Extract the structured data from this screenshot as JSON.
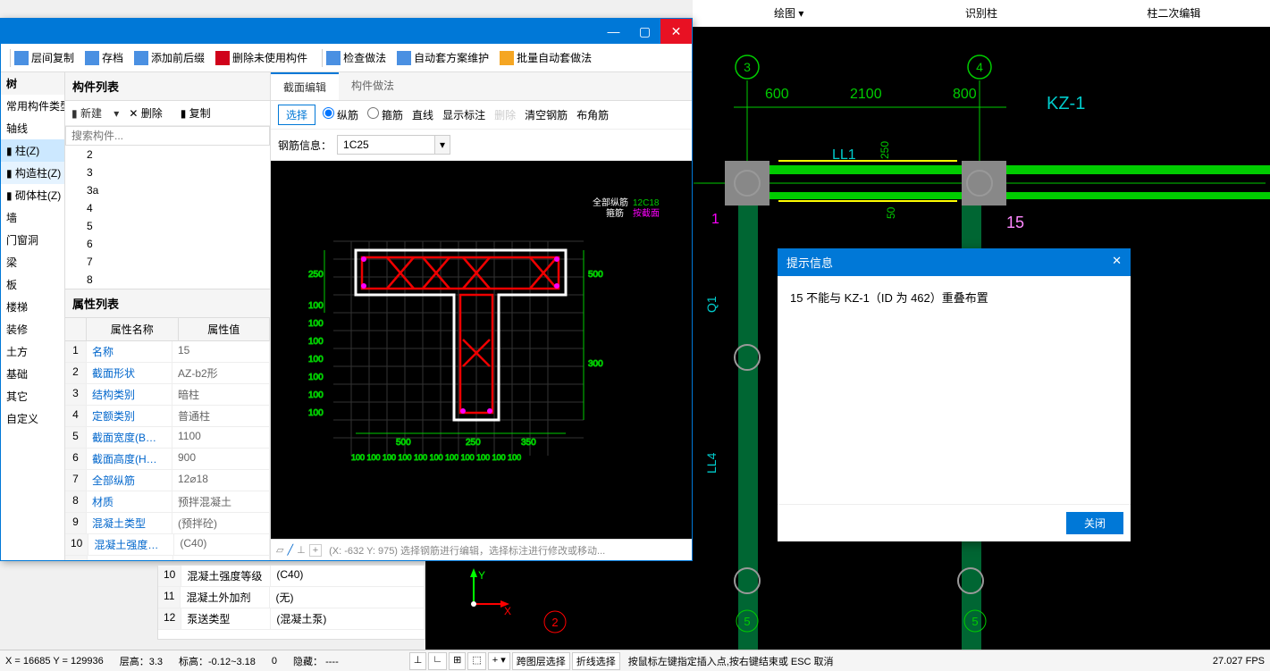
{
  "cad_ribbon": {
    "draw": "绘图",
    "recognize": "识别柱",
    "edit2": "柱二次编辑"
  },
  "toolbar": {
    "layer_copy": "层间复制",
    "archive": "存档",
    "add_prefix": "添加前后缀",
    "delete_unused": "删除未使用构件",
    "check_method": "检查做法",
    "auto_method_maint": "自动套方案维护",
    "batch_auto_method": "批量自动套做法"
  },
  "tree": {
    "title": "树",
    "header": "常用构件类型",
    "items": [
      "轴线",
      "柱(Z)",
      "构造柱(Z)",
      "砌体柱(Z)",
      "墙",
      "门窗洞",
      "梁",
      "板",
      "楼梯",
      "装修",
      "土方",
      "基础",
      "其它",
      "自定义"
    ]
  },
  "comp": {
    "title": "构件列表",
    "new": "新建",
    "delete": "删除",
    "copy": "复制",
    "search_placeholder": "搜索构件...",
    "items": [
      "2",
      "3",
      "3a",
      "4",
      "5",
      "6",
      "7",
      "8"
    ]
  },
  "props": {
    "title": "属性列表",
    "col_name": "属性名称",
    "col_val": "属性值",
    "rows": [
      {
        "n": "1",
        "name": "名称",
        "val": "15"
      },
      {
        "n": "2",
        "name": "截面形状",
        "val": "AZ-b2形"
      },
      {
        "n": "3",
        "name": "结构类别",
        "val": "暗柱"
      },
      {
        "n": "4",
        "name": "定额类别",
        "val": "普通柱"
      },
      {
        "n": "5",
        "name": "截面宽度(B边)(...",
        "val": "1100"
      },
      {
        "n": "6",
        "name": "截面高度(H边)(...",
        "val": "900"
      },
      {
        "n": "7",
        "name": "全部纵筋",
        "val": "12⌀18"
      },
      {
        "n": "8",
        "name": "材质",
        "val": "预拌混凝土"
      },
      {
        "n": "9",
        "name": "混凝土类型",
        "val": "(预拌砼)"
      },
      {
        "n": "10",
        "name": "混凝土强度等级",
        "val": "(C40)"
      },
      {
        "n": "11",
        "name": "混凝土外加剂",
        "val": "(无)"
      },
      {
        "n": "12",
        "name": "泵送类型",
        "val": "(混凝土泵)"
      }
    ]
  },
  "lower_props": [
    {
      "n": "10",
      "name": "混凝土强度等级",
      "val": "(C40)"
    },
    {
      "n": "11",
      "name": "混凝土外加剂",
      "val": "(无)"
    },
    {
      "n": "12",
      "name": "泵送类型",
      "val": "(混凝土泵)"
    }
  ],
  "edit": {
    "tab1": "截面编辑",
    "tab2": "构件做法",
    "select": "选择",
    "radio1": "纵筋",
    "radio2": "箍筋",
    "line": "直线",
    "show_label": "显示标注",
    "delete": "删除",
    "clear": "清空钢筋",
    "corner": "布角筋",
    "rebar_label": "钢筋信息：",
    "rebar_value": "1C25",
    "status": "(X: -632 Y: 975)  选择钢筋进行编辑，选择标注进行修改或移动...",
    "legend1": "全部纵筋",
    "legend1v": "12C18",
    "legend2": "箍筋",
    "legend2v": "按截面"
  },
  "dialog": {
    "title": "提示信息",
    "body": "15 不能与 KZ-1（ID 为 462）重叠布置",
    "close_btn": "关闭"
  },
  "status": {
    "xy": "X = 16685 Y = 129936",
    "floor": "层高：3.3",
    "elev": "标高：-0.12~3.18",
    "zero": "0",
    "hide": "隐藏：",
    "none": "----",
    "cross_layer": "跨图层选择",
    "polyline": "折线选择",
    "hint": "按鼠标左键指定插入点,按右键结束或 ESC 取消",
    "fps": "27.027 FPS"
  },
  "cad": {
    "kz1": "KZ-1",
    "ll1": "LL1",
    "label15": "15",
    "q1": "Q1",
    "ll4": "LL4",
    "dim600": "600",
    "dim2100": "2100",
    "dim800": "800",
    "dim250": "250",
    "dim50": "50",
    "axisA": "3",
    "axisB": "4",
    "axisBot": "5",
    "axis2": "2",
    "axis1": "1"
  },
  "section": {
    "dim250": "250",
    "dim100": "100",
    "dim500r": "500",
    "dim300": "300",
    "dim500b": "500",
    "dim250b": "250",
    "dim350": "350",
    "small100": "100"
  }
}
